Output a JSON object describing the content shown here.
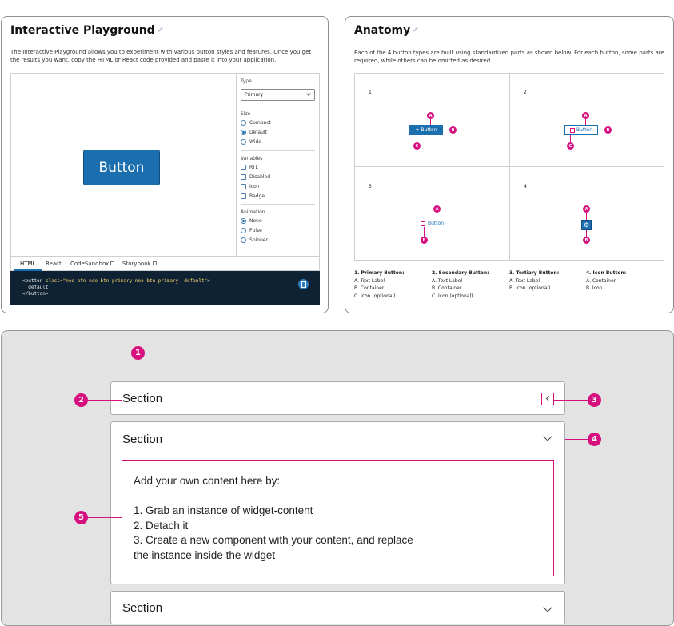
{
  "playground": {
    "title": "Interactive Playground",
    "description": "The Interactive Playground allows you to experiment with various button styles and features. Once you get the results you want, copy the HTML or React code provided and paste it into your application.",
    "preview_button_label": "Button",
    "type_label": "Type",
    "type_value": "Primary",
    "size_label": "Size",
    "size_options": [
      "Compact",
      "Default",
      "Wide"
    ],
    "size_selected": "Default",
    "variables_label": "Variables",
    "variables": [
      "RTL",
      "Disabled",
      "Icon",
      "Badge"
    ],
    "animation_label": "Animation",
    "animation_options": [
      "None",
      "Pulse",
      "Spinner"
    ],
    "animation_selected": "None",
    "tabs": [
      "HTML",
      "React",
      "CodeSandbox",
      "Storybook"
    ],
    "active_tab": "HTML",
    "code": {
      "line1_open": "<button ",
      "line1_attr": "class=",
      "line1_str": "\"neo-btn neo-btn-primary neo-btn-primary--default\"",
      "line1_close": ">",
      "line2": "  default",
      "line3": "</button>"
    }
  },
  "anatomy": {
    "title": "Anatomy",
    "description": "Each of the 4 button types are built using standardized parts as shown below. For each button, some parts are required, while others can be omitted as desired.",
    "cells": [
      "1",
      "2",
      "3",
      "4"
    ],
    "mini_label": "Button",
    "markers": [
      "A",
      "B",
      "C"
    ],
    "legend": [
      {
        "title": "1. Primary Button:",
        "items": [
          "A. Text Label",
          "B. Container",
          "C. Icon (optional)"
        ]
      },
      {
        "title": "2. Secondary Button:",
        "items": [
          "A. Text Label",
          "B. Container",
          "C. Icon (optional)"
        ]
      },
      {
        "title": "3. Tertiary Button:",
        "items": [
          "A. Text Label",
          "B. Icon (optional)"
        ]
      },
      {
        "title": "4. Icon Button:",
        "items": [
          "A. Container",
          "B. Icon"
        ]
      }
    ]
  },
  "widget": {
    "section_title": "Section",
    "markers": [
      "1",
      "2",
      "3",
      "4",
      "5"
    ],
    "content_text": "Add your own content here by:\n\n1. Grab an instance of widget-content\n2. Detach it\n3. Create a new component with your content, and replace\nthe instance inside the widget"
  },
  "colors": {
    "accent": "#d6117f",
    "primary": "#1b6fae",
    "code_bg": "#0f2233"
  }
}
